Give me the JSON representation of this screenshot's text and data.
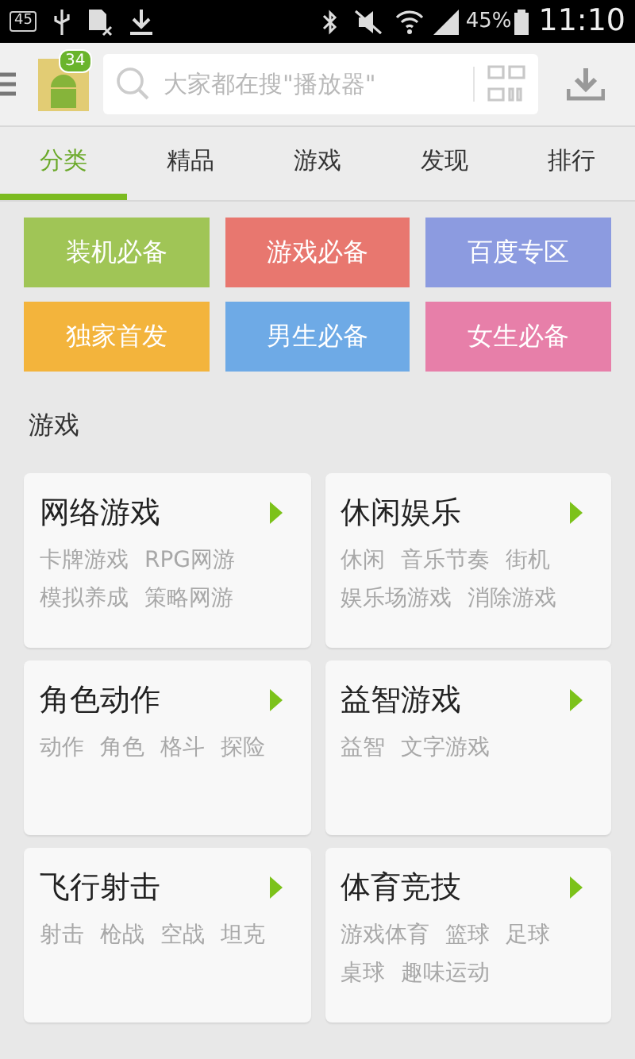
{
  "status_bar": {
    "notification_badge": "45",
    "battery": "45%",
    "time": "11:10"
  },
  "header": {
    "badge": "34",
    "search": {
      "placeholder": "大家都在搜\"播放器\""
    }
  },
  "tabs": [
    {
      "label": "分类",
      "selected": true
    },
    {
      "label": "精品",
      "selected": false
    },
    {
      "label": "游戏",
      "selected": false
    },
    {
      "label": "发现",
      "selected": false
    },
    {
      "label": "排行",
      "selected": false
    }
  ],
  "tiles": [
    {
      "label": "装机必备",
      "color": "#a0c556"
    },
    {
      "label": "游戏必备",
      "color": "#e8776f"
    },
    {
      "label": "百度专区",
      "color": "#8c9be0"
    },
    {
      "label": "独家首发",
      "color": "#f3b43c"
    },
    {
      "label": "男生必备",
      "color": "#6eaae6"
    },
    {
      "label": "女生必备",
      "color": "#e77fa9"
    }
  ],
  "section_title": "游戏",
  "categories": [
    {
      "title": "网络游戏",
      "tags": [
        "卡牌游戏",
        "RPG网游",
        "模拟养成",
        "策略网游"
      ]
    },
    {
      "title": "休闲娱乐",
      "tags": [
        "休闲",
        "音乐节奏",
        "街机",
        "娱乐场游戏",
        "消除游戏"
      ]
    },
    {
      "title": "角色动作",
      "tags": [
        "动作",
        "角色",
        "格斗",
        "探险"
      ]
    },
    {
      "title": "益智游戏",
      "tags": [
        "益智",
        "文字游戏"
      ]
    },
    {
      "title": "飞行射击",
      "tags": [
        "射击",
        "枪战",
        "空战",
        "坦克"
      ]
    },
    {
      "title": "体育竞技",
      "tags": [
        "游戏体育",
        "篮球",
        "足球",
        "桌球",
        "趣味运动"
      ]
    }
  ]
}
